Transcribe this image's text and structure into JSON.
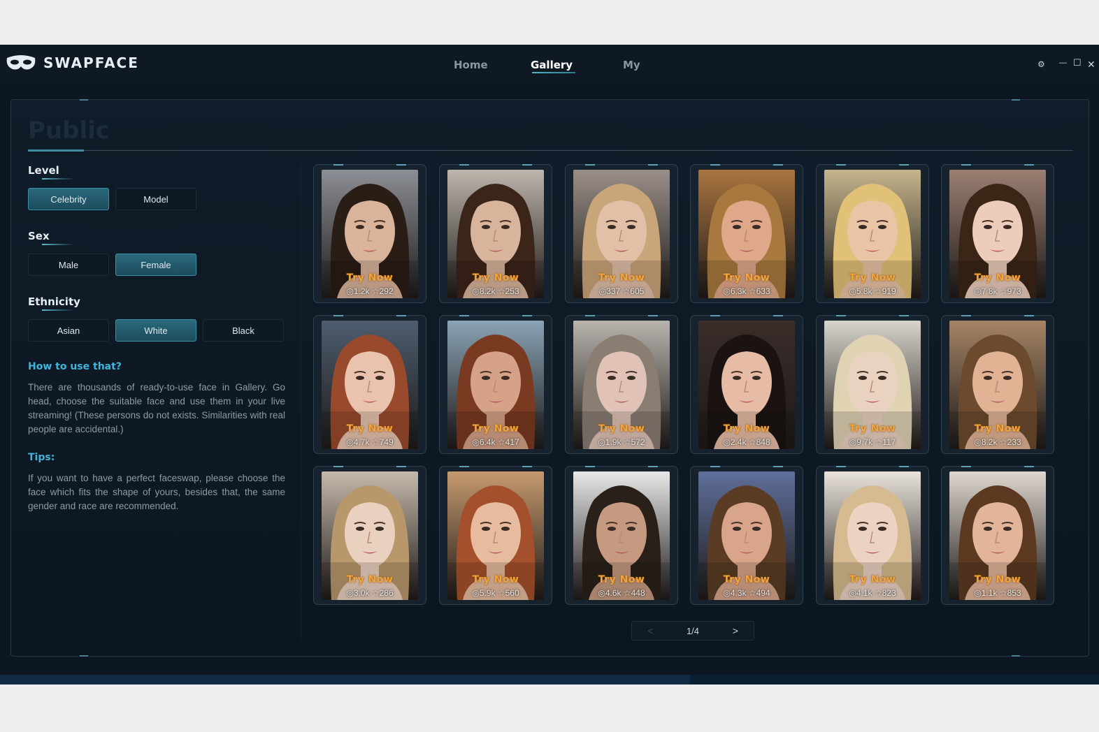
{
  "app": {
    "name": "SWAPFACE",
    "nav": [
      {
        "label": "Home",
        "active": false
      },
      {
        "label": "Gallery",
        "active": true
      },
      {
        "label": "My",
        "active": false
      }
    ],
    "controls": {
      "settings": "⚙",
      "minimize": "—",
      "maximize": "☐",
      "close": "✕"
    }
  },
  "panel": {
    "title": "Public"
  },
  "filters": {
    "level": {
      "title": "Level",
      "options": [
        {
          "label": "Celebrity",
          "active": true
        },
        {
          "label": "Model",
          "active": false
        }
      ]
    },
    "sex": {
      "title": "Sex",
      "options": [
        {
          "label": "Male",
          "active": false
        },
        {
          "label": "Female",
          "active": true
        }
      ]
    },
    "ethnicity": {
      "title": "Ethnicity",
      "options": [
        {
          "label": "Asian",
          "active": false
        },
        {
          "label": "White",
          "active": true
        },
        {
          "label": "Black",
          "active": false
        }
      ]
    }
  },
  "help": {
    "how_title": "How to use that?",
    "how_text": "There are thousands of ready-to-use face in Gallery. Go head, choose the suitable face and use them in your live streaming! (These persons do not exists. Similarities with real people are accidental.)",
    "tips_title": "Tips:",
    "tips_text": "If you want to have a perfect faceswap, please choose the face which fits the shape of yours, besides that, the same gender and race are recommended."
  },
  "cards": [
    {
      "cta": "Try Now",
      "views": "1.2k",
      "stars": "292",
      "hair": "#2a1d15",
      "skin": "#d9b39a",
      "bg": "#8c8f96"
    },
    {
      "cta": "Try Now",
      "views": "8.2k",
      "stars": "253",
      "hair": "#3b2418",
      "skin": "#d9b49c",
      "bg": "#bdb6ad"
    },
    {
      "cta": "Try Now",
      "views": "337",
      "stars": "605",
      "hair": "#c9a57a",
      "skin": "#e2c0a8",
      "bg": "#9a8f88"
    },
    {
      "cta": "Try Now",
      "views": "6.3k",
      "stars": "633",
      "hair": "#a8793f",
      "skin": "#e0a88a",
      "bg": "#a8743f"
    },
    {
      "cta": "Try Now",
      "views": "5.8k",
      "stars": "919",
      "hair": "#e1c178",
      "skin": "#e9c5a6",
      "bg": "#c5b58d"
    },
    {
      "cta": "Try Now",
      "views": "7.8k",
      "stars": "973",
      "hair": "#3a2517",
      "skin": "#eccdbb",
      "bg": "#9b7f72"
    },
    {
      "cta": "Try Now",
      "views": "4.7k",
      "stars": "749",
      "hair": "#9a4a2c",
      "skin": "#e9c3ae",
      "bg": "#4d5d6e"
    },
    {
      "cta": "Try Now",
      "views": "6.4k",
      "stars": "417",
      "hair": "#7a3a22",
      "skin": "#d5a187",
      "bg": "#8aa3b5"
    },
    {
      "cta": "Try Now",
      "views": "1.9k",
      "stars": "572",
      "hair": "#8a7d72",
      "skin": "#e0c3b6",
      "bg": "#b8b3ad"
    },
    {
      "cta": "Try Now",
      "views": "2.4k",
      "stars": "848",
      "hair": "#1a1311",
      "skin": "#e7bca6",
      "bg": "#3a2d2a"
    },
    {
      "cta": "Try Now",
      "views": "9.7k",
      "stars": "117",
      "hair": "#e0d3b3",
      "skin": "#ead2c0",
      "bg": "#d7d4cc"
    },
    {
      "cta": "Try Now",
      "views": "8.2k",
      "stars": "233",
      "hair": "#6b4a2e",
      "skin": "#e1b394",
      "bg": "#a58466"
    },
    {
      "cta": "Try Now",
      "views": "3.0k",
      "stars": "286",
      "hair": "#b8976b",
      "skin": "#ead0bf",
      "bg": "#c5b9ab"
    },
    {
      "cta": "Try Now",
      "views": "5.9k",
      "stars": "560",
      "hair": "#a5502c",
      "skin": "#e6bb9e",
      "bg": "#c69a6f"
    },
    {
      "cta": "Try Now",
      "views": "4.6k",
      "stars": "448",
      "hair": "#2a201a",
      "skin": "#c59a80",
      "bg": "#e8e8e8"
    },
    {
      "cta": "Try Now",
      "views": "4.3k",
      "stars": "494",
      "hair": "#5a3c24",
      "skin": "#d8a58a",
      "bg": "#5f6f9c"
    },
    {
      "cta": "Try Now",
      "views": "4.1k",
      "stars": "823",
      "hair": "#d5bb8f",
      "skin": "#ecd2c2",
      "bg": "#e9e3dc"
    },
    {
      "cta": "Try Now",
      "views": "1.1k",
      "stars": "853",
      "hair": "#5c3a22",
      "skin": "#e2b49a",
      "bg": "#dfd7cf"
    }
  ],
  "pager": {
    "prev": "<",
    "page": "1/4",
    "next": ">"
  }
}
